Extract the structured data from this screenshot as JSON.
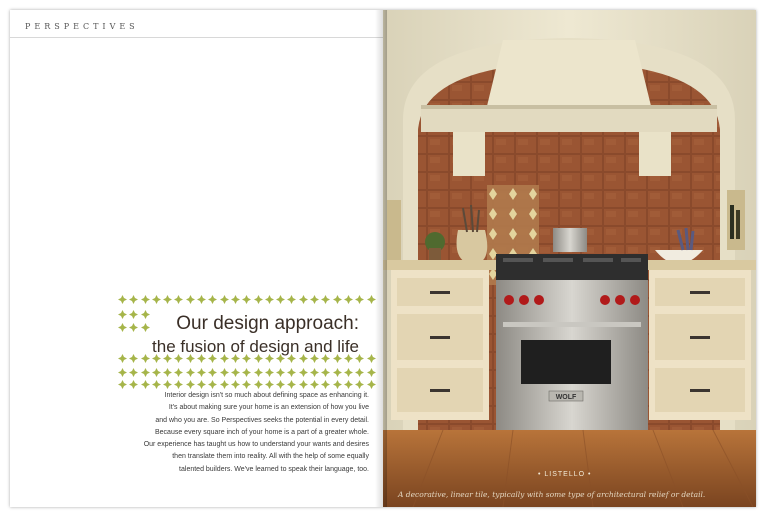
{
  "running_head": "PERSPECTIVES",
  "heading": {
    "line1": "Our design approach:",
    "line2": "the fusion of design and life"
  },
  "body_lines": [
    "Interior design isn't so much about defining space as enhancing it.",
    "It's about making sure your home is an extension of how you live",
    "and who you are. So Perspectives seeks the potential in every detail.",
    "Because every square inch of your home is a part of a greater whole.",
    "Our experience has taught us how to understand your wants and desires",
    "then translate them into reality. All with the help of some equally",
    "talented builders. We've learned to speak their language, too."
  ],
  "photo": {
    "brand_plate": "WOLF",
    "caption_name": "• LISTELLO •",
    "caption_text": "A decorative, linear tile, typically with some type of architectural relief or detail."
  },
  "colors": {
    "accent_green": "#a6b54a",
    "title_brown": "#3a2f27",
    "tile_terracotta": "#8a4a2c",
    "cabinet_cream": "#eee2c6"
  }
}
